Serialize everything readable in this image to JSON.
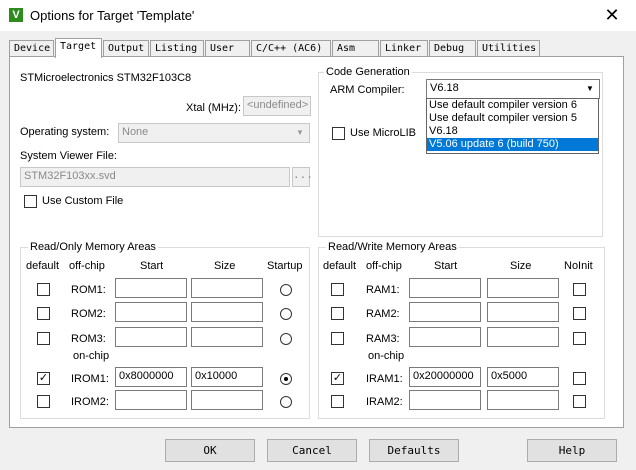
{
  "window": {
    "title": "Options for Target 'Template'",
    "app_icon": "V"
  },
  "tabs": [
    "Device",
    "Target",
    "Output",
    "Listing",
    "User",
    "C/C++ (AC6)",
    "Asm",
    "Linker",
    "Debug",
    "Utilities"
  ],
  "active_tab": "Target",
  "target": {
    "device_name": "STMicroelectronics STM32F103C8",
    "xtal_label": "Xtal (MHz):",
    "xtal_value": "<undefined>",
    "os_label": "Operating system:",
    "os_value": "None",
    "svd_label": "System Viewer File:",
    "svd_value": "STM32F103xx.svd",
    "svd_browse": "...",
    "use_custom_file": "Use Custom File"
  },
  "codegen": {
    "group_title": "Code Generation",
    "compiler_label": "ARM Compiler:",
    "compiler_value": "V6.18",
    "use_microlib": "Use MicroLIB",
    "dropdown_options": [
      "Use default compiler version 6",
      "Use default compiler version 5",
      "V6.18",
      "V5.06 update 6 (build 750)"
    ],
    "dropdown_highlight_index": 3
  },
  "ro_memory": {
    "title": "Read/Only Memory Areas",
    "headers": {
      "default": "default",
      "offchip": "off-chip",
      "start": "Start",
      "size": "Size",
      "last": "Startup"
    },
    "onchip_label": "on-chip",
    "rows": [
      {
        "name": "ROM1:",
        "start": "",
        "size": "",
        "default": false,
        "flag": false
      },
      {
        "name": "ROM2:",
        "start": "",
        "size": "",
        "default": false,
        "flag": false
      },
      {
        "name": "ROM3:",
        "start": "",
        "size": "",
        "default": false,
        "flag": false
      },
      {
        "name": "IROM1:",
        "start": "0x8000000",
        "size": "0x10000",
        "default": true,
        "flag": true
      },
      {
        "name": "IROM2:",
        "start": "",
        "size": "",
        "default": false,
        "flag": false
      }
    ]
  },
  "rw_memory": {
    "title": "Read/Write Memory Areas",
    "headers": {
      "default": "default",
      "offchip": "off-chip",
      "start": "Start",
      "size": "Size",
      "last": "NoInit"
    },
    "onchip_label": "on-chip",
    "rows": [
      {
        "name": "RAM1:",
        "start": "",
        "size": "",
        "default": false,
        "flag": false
      },
      {
        "name": "RAM2:",
        "start": "",
        "size": "",
        "default": false,
        "flag": false
      },
      {
        "name": "RAM3:",
        "start": "",
        "size": "",
        "default": false,
        "flag": false
      },
      {
        "name": "IRAM1:",
        "start": "0x20000000",
        "size": "0x5000",
        "default": true,
        "flag": false
      },
      {
        "name": "IRAM2:",
        "start": "",
        "size": "",
        "default": false,
        "flag": false
      }
    ]
  },
  "buttons": {
    "ok": "OK",
    "cancel": "Cancel",
    "defaults": "Defaults",
    "help": "Help"
  },
  "check_glyph": "✓",
  "close_glyph": "✕",
  "combo_arrow_glyph": "▼"
}
